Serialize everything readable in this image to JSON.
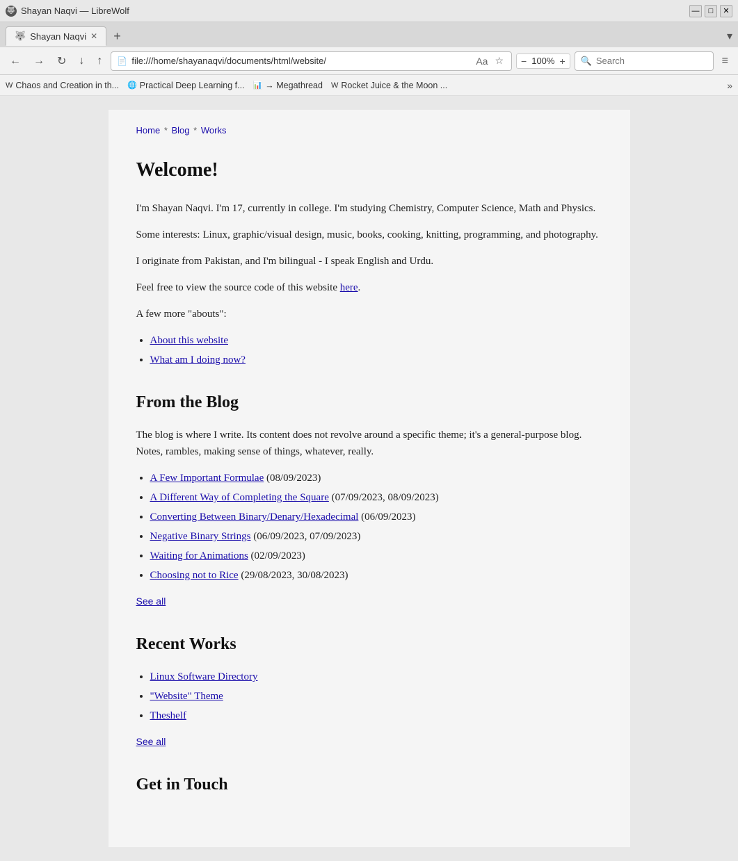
{
  "window": {
    "title": "Shayan Naqvi — LibreWolf",
    "controls": {
      "minimize": "—",
      "maximize": "□",
      "close": "✕"
    }
  },
  "tab": {
    "icon": "🐺",
    "label": "Shayan Naqvi",
    "close": "✕"
  },
  "navbar": {
    "back": "←",
    "forward": "→",
    "reload": "↻",
    "download": "↓",
    "share": "↑",
    "address_icon": "📄",
    "address": "file:///home/shayanaqvi/documents/html/website/",
    "reader_icon": "Aa",
    "bookmark_icon": "☆",
    "zoom_minus": "−",
    "zoom_level": "100%",
    "zoom_plus": "+",
    "search_placeholder": "Search",
    "menu_icon": "≡"
  },
  "bookmarks": [
    {
      "icon": "W",
      "label": "Chaos and Creation in th..."
    },
    {
      "icon": "🌐",
      "label": "Practical Deep Learning f..."
    },
    {
      "icon": "📊",
      "label": "→ Megathread"
    },
    {
      "icon": "W",
      "label": "Rocket Juice & the Moon ..."
    }
  ],
  "breadcrumb": {
    "home": "Home",
    "blog": "Blog",
    "works": "Works",
    "sep1": "*",
    "sep2": "*"
  },
  "welcome": {
    "heading": "Welcome!",
    "para1": "I'm Shayan Naqvi. I'm 17, currently in college. I'm studying Chemistry, Computer Science, Math and Physics.",
    "para2": "Some interests: Linux, graphic/visual design, music, books, cooking, knitting, programming, and photography.",
    "para3": "I originate from Pakistan, and I'm bilingual - I speak English and Urdu.",
    "para4_prefix": "Feel free to view the source code of this website ",
    "here_link": "here",
    "para4_suffix": ".",
    "para5": "A few more \"abouts\":",
    "links": [
      {
        "label": "About this website"
      },
      {
        "label": "What am I doing now?"
      }
    ]
  },
  "blog": {
    "heading": "From the Blog",
    "description": "The blog is where I write. Its content does not revolve around a specific theme; it's a general-purpose blog. Notes, rambles, making sense of things, whatever, really.",
    "posts": [
      {
        "title": "A Few Important Formulae",
        "date": "(08/09/2023)"
      },
      {
        "title": "A Different Way of Completing the Square",
        "date": "(07/09/2023, 08/09/2023)"
      },
      {
        "title": "Converting Between Binary/Denary/Hexadecimal",
        "date": "(06/09/2023)"
      },
      {
        "title": "Negative Binary Strings",
        "date": "(06/09/2023, 07/09/2023)"
      },
      {
        "title": "Waiting for Animations",
        "date": "(02/09/2023)"
      },
      {
        "title": "Choosing not to Rice",
        "date": "(29/08/2023, 30/08/2023)"
      }
    ],
    "see_all": "See all"
  },
  "works": {
    "heading": "Recent Works",
    "items": [
      {
        "title": "Linux Software Directory"
      },
      {
        "title": "\"Website\" Theme"
      },
      {
        "title": "Theshelf"
      }
    ],
    "see_all": "See all"
  },
  "contact": {
    "heading": "Get in Touch"
  }
}
